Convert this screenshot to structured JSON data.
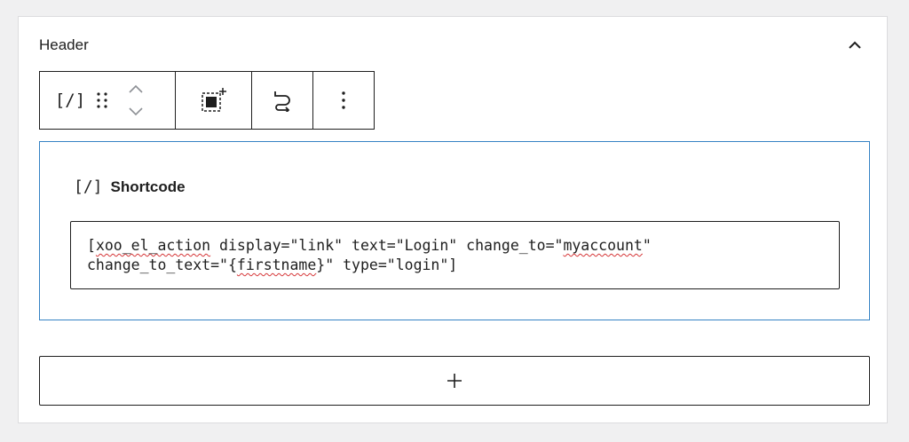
{
  "panel": {
    "title": "Header",
    "collapse_icon": "chevron-up-icon"
  },
  "toolbar": {
    "block_type_label": "[/]",
    "block_type_icon": "shortcode-icon",
    "drag_icon": "drag-handle-icon",
    "move_up_icon": "chevron-up-icon",
    "move_down_icon": "chevron-down-icon",
    "select_icon": "select-parent-icon",
    "transform_icon": "loop-arrow-icon",
    "more_icon": "vertical-ellipsis-icon"
  },
  "block": {
    "icon_label": "[/]",
    "label": "Shortcode",
    "code_prefix": "[",
    "code_word1": "xoo_el_action",
    "code_mid1": " display=\"link\" text=\"Login\" change_to=\"",
    "code_word2": "myaccount",
    "code_mid2": "\"\nchange_to_text=\"{",
    "code_word3": "firstname",
    "code_suffix": "}\" type=\"login\"]"
  },
  "appender": {
    "icon": "plus-icon"
  },
  "colors": {
    "background": "#f0f0f1",
    "panel": "#ffffff",
    "border": "#1e1e1e",
    "block_outline": "#3582c4",
    "spellcheck": "#d63638"
  }
}
